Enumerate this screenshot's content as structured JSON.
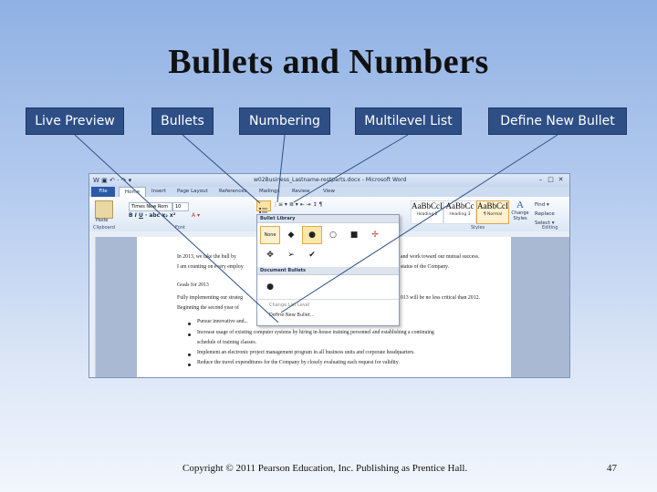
{
  "slide": {
    "title": "Bullets and Numbers",
    "labels": [
      "Live Preview",
      "Bullets",
      "Numbering",
      "Multilevel List",
      "Define New Bullet"
    ],
    "footer": "Copyright © 2011 Pearson Education, Inc. Publishing as Prentice Hall.",
    "page_number": "47"
  },
  "word": {
    "title": "w02Business_Lastname-restparts.docx - Microsoft Word",
    "qat": "W ▣ ↶ · ↷ ▾",
    "window_controls": [
      "–",
      "□",
      "✕"
    ],
    "tabs": [
      "File",
      "Home",
      "Insert",
      "Page Layout",
      "References",
      "Mailings",
      "Review",
      "View"
    ],
    "ribbon": {
      "paste_label": "Paste",
      "font_name": "Times New Rom",
      "font_size": "10",
      "groups": [
        "Clipboard",
        "Font",
        "Styles",
        "Editing"
      ],
      "styles": [
        {
          "sample": "AaBbCcI",
          "name": "Heading 2"
        },
        {
          "sample": "AaBbCc",
          "name": "Heading 3"
        },
        {
          "sample": "AaBbCcI",
          "name": "¶ Normal"
        }
      ],
      "change_styles": "Change Styles",
      "editing": [
        "Find ▾",
        "Replace",
        "Select ▾"
      ]
    },
    "bullet_dropdown": {
      "library_header": "Bullet Library",
      "none_label": "None",
      "library_symbols": [
        "◆",
        "●",
        "○",
        "■",
        "✢",
        "✥",
        "➢",
        "✔"
      ],
      "document_header": "Document Bullets",
      "document_symbols": [
        "●"
      ],
      "menu": [
        "Change List Level",
        "Define New Bullet..."
      ]
    },
    "document": {
      "line1a": "In 2013, we take the bull by",
      "line1b": "and work toward our mutual success.",
      "line2a": "I am counting on every employ",
      "line2b": "status of the Company.",
      "goals_heading": "Goals for 2013",
      "line3a": "Fully implementing our strateg",
      "line3b": "013 will be no less critical than 2012.",
      "line4a": "Beginning the second year of",
      "bullets": [
        "Pursue innovative and...",
        "Increase usage of existing computer systems by hiring in-house training personnel and establishing a continuing",
        "schedule of training classes.",
        "Implement an electronic project management program in all business units and corporate headquarters.",
        "Reduce the travel expenditures for the Company by closely evaluating each request for validity."
      ]
    }
  }
}
